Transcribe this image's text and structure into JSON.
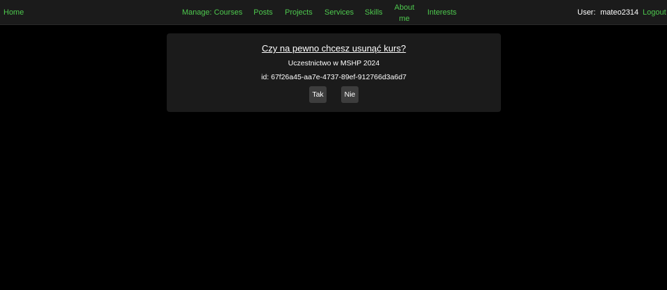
{
  "nav": {
    "home": "Home",
    "manage_label": "Manage:",
    "items": [
      "Courses",
      "Posts",
      "Projects",
      "Services",
      "Skills",
      "About me",
      "Interests"
    ],
    "user_label": "User:",
    "username": "mateo2314",
    "logout": "Logout"
  },
  "dialog": {
    "title": "Czy na pewno chcesz usunąć kurs?",
    "course_name": "Uczestnictwo w MSHP 2024",
    "id_text": "id: 67f26a45-aa7e-4737-89ef-912766d3a6d7",
    "confirm_label": "Tak",
    "cancel_label": "Nie"
  },
  "colors": {
    "background": "#000000",
    "navbar": "#1b1b1b",
    "link": "#4ec94e",
    "panel": "#1b1b1b",
    "button": "#3d3d3d"
  }
}
